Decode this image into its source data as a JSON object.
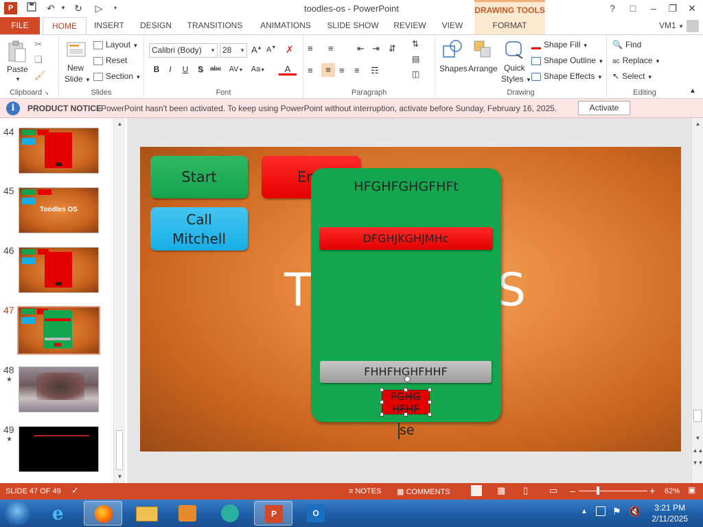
{
  "window": {
    "title": "toodles-os - PowerPoint",
    "context_tab_group": "DRAWING TOOLS",
    "help": "?",
    "user": "VM1"
  },
  "tabs": [
    "FILE",
    "HOME",
    "INSERT",
    "DESIGN",
    "TRANSITIONS",
    "ANIMATIONS",
    "SLIDE SHOW",
    "REVIEW",
    "VIEW",
    "FORMAT"
  ],
  "ribbon": {
    "clipboard": {
      "label": "Clipboard",
      "paste": "Paste"
    },
    "slides": {
      "label": "Slides",
      "new_slide_line1": "New",
      "new_slide_line2": "Slide",
      "layout": "Layout",
      "reset": "Reset",
      "section": "Section"
    },
    "font": {
      "label": "Font",
      "family": "Calibri (Body)",
      "size": "28"
    },
    "paragraph": {
      "label": "Paragraph"
    },
    "drawing": {
      "label": "Drawing",
      "shapes": "Shapes",
      "arrange": "Arrange",
      "quick_styles_line1": "Quick",
      "quick_styles_line2": "Styles",
      "shape_fill": "Shape Fill",
      "shape_outline": "Shape Outline",
      "shape_effects": "Shape Effects"
    },
    "editing": {
      "label": "Editing",
      "find": "Find",
      "replace": "Replace",
      "select": "Select"
    }
  },
  "notice": {
    "title": "PRODUCT NOTICE",
    "message": "PowerPoint hasn't been activated. To keep using PowerPoint without interruption, activate before Sunday, February 16, 2025.",
    "button": "Activate"
  },
  "thumbnails": [
    {
      "num": "44",
      "star": ""
    },
    {
      "num": "45",
      "star": "",
      "text": "Toodles OS"
    },
    {
      "num": "46",
      "star": ""
    },
    {
      "num": "47",
      "star": "",
      "selected": true
    },
    {
      "num": "48",
      "star": "★"
    },
    {
      "num": "49",
      "star": "★"
    }
  ],
  "slide": {
    "start": "Start",
    "end_partial": "En",
    "call_line1": "Call",
    "call_line2": "Mitchell",
    "title_left": "T",
    "title_right": "S",
    "panel_title": "HFGHFGHGFHFt",
    "red_bar": "DFGHJKGHJMHc",
    "gray_bar": "FHHFHGHFHHF",
    "small_red_line1": "FGHG",
    "small_red_line2": "HFHF",
    "caption": "se"
  },
  "status": {
    "slide_of": "SLIDE 47 OF 49",
    "notes": "NOTES",
    "comments": "COMMENTS",
    "zoom": "62%"
  },
  "taskbar": {
    "time": "3:21 PM",
    "date": "2/11/2025"
  },
  "colors": {
    "accent": "#d24726",
    "slide_green": "#12a74e",
    "slide_red": "#e40000",
    "slide_blue": "#17aee6",
    "notice_bg": "#fce4e4"
  }
}
